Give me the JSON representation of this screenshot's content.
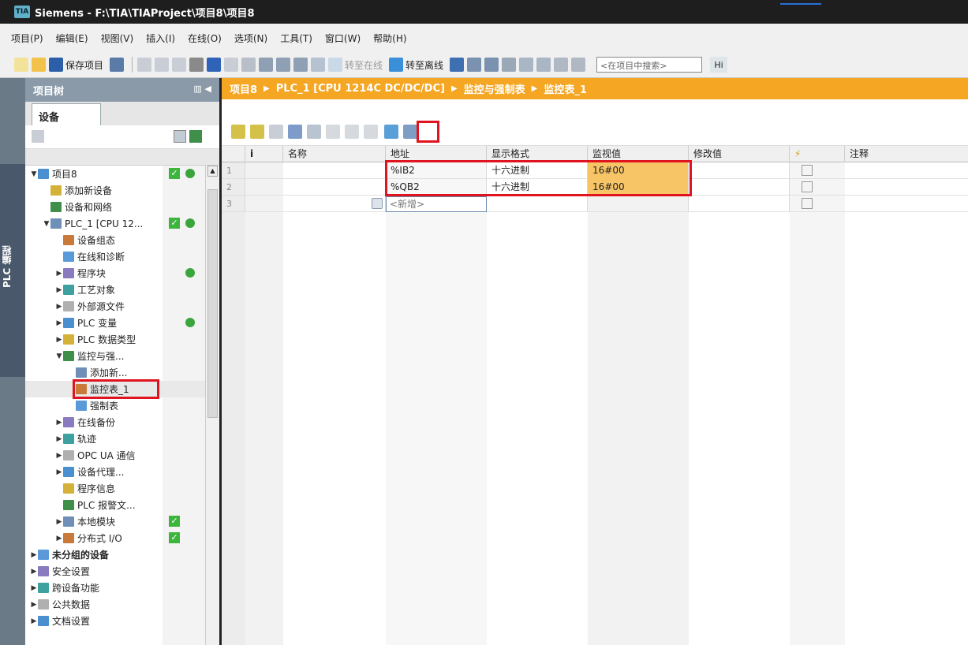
{
  "window": {
    "title": "Siemens  -  F:\\TIA\\TIAProject\\项目8\\项目8",
    "logo_text": "TIA"
  },
  "menu": [
    "项目(P)",
    "编辑(E)",
    "视图(V)",
    "插入(I)",
    "在线(O)",
    "选项(N)",
    "工具(T)",
    "窗口(W)",
    "帮助(H)"
  ],
  "toolbar": {
    "save_label": "保存项目",
    "go_online_label": "转至在线",
    "go_offline_label": "转至离线",
    "search_placeholder": "<在项目中搜索>",
    "find_icon_text": "Hi"
  },
  "left_strip": {
    "label": "PLC 编程"
  },
  "project_tree": {
    "header": "项目树",
    "devices_tab": "设备",
    "items": [
      {
        "label": "项目8",
        "indent": 0,
        "arrow": "down",
        "icon": "project-icon",
        "check": true,
        "dot": true
      },
      {
        "label": "添加新设备",
        "indent": 1,
        "arrow": "",
        "icon": "add-device-icon"
      },
      {
        "label": "设备和网络",
        "indent": 1,
        "arrow": "",
        "icon": "network-icon"
      },
      {
        "label": "PLC_1 [CPU 12...",
        "indent": 1,
        "arrow": "down",
        "icon": "plc-icon",
        "check": true,
        "dot": true
      },
      {
        "label": "设备组态",
        "indent": 2,
        "arrow": "",
        "icon": "device-config-icon"
      },
      {
        "label": "在线和诊断",
        "indent": 2,
        "arrow": "",
        "icon": "diagnostics-icon"
      },
      {
        "label": "程序块",
        "indent": 2,
        "arrow": "right",
        "icon": "program-blocks-icon",
        "dot": true
      },
      {
        "label": "工艺对象",
        "indent": 2,
        "arrow": "right",
        "icon": "technology-objects-icon"
      },
      {
        "label": "外部源文件",
        "indent": 2,
        "arrow": "right",
        "icon": "external-source-icon"
      },
      {
        "label": "PLC 变量",
        "indent": 2,
        "arrow": "right",
        "icon": "plc-tags-icon",
        "dot": true
      },
      {
        "label": "PLC 数据类型",
        "indent": 2,
        "arrow": "right",
        "icon": "plc-datatypes-icon"
      },
      {
        "label": "监控与强...",
        "indent": 2,
        "arrow": "down",
        "icon": "watch-force-folder-icon"
      },
      {
        "label": "添加新...",
        "indent": 3,
        "arrow": "",
        "icon": "add-new-icon"
      },
      {
        "label": "监控表_1",
        "indent": 3,
        "arrow": "",
        "icon": "watch-table-icon",
        "selected": true
      },
      {
        "label": "强制表",
        "indent": 3,
        "arrow": "",
        "icon": "force-table-icon"
      },
      {
        "label": "在线备份",
        "indent": 2,
        "arrow": "right",
        "icon": "online-backup-icon"
      },
      {
        "label": "轨迹",
        "indent": 2,
        "arrow": "right",
        "icon": "traces-icon"
      },
      {
        "label": "OPC UA 通信",
        "indent": 2,
        "arrow": "right",
        "icon": "opcua-icon"
      },
      {
        "label": "设备代理...",
        "indent": 2,
        "arrow": "right",
        "icon": "device-proxy-icon"
      },
      {
        "label": "程序信息",
        "indent": 2,
        "arrow": "",
        "icon": "program-info-icon"
      },
      {
        "label": "PLC 报警文...",
        "indent": 2,
        "arrow": "",
        "icon": "plc-alarm-icon"
      },
      {
        "label": "本地模块",
        "indent": 2,
        "arrow": "right",
        "icon": "local-modules-icon",
        "check": true
      },
      {
        "label": "分布式 I/O",
        "indent": 2,
        "arrow": "right",
        "icon": "distributed-io-icon",
        "check": true
      },
      {
        "label": "未分组的设备",
        "indent": 0,
        "arrow": "right",
        "icon": "ungrouped-devices-icon",
        "bold": true
      },
      {
        "label": "安全设置",
        "indent": 0,
        "arrow": "right",
        "icon": "security-icon"
      },
      {
        "label": "跨设备功能",
        "indent": 0,
        "arrow": "right",
        "icon": "cross-device-icon"
      },
      {
        "label": "公共数据",
        "indent": 0,
        "arrow": "right",
        "icon": "common-data-icon"
      },
      {
        "label": "文档设置",
        "indent": 0,
        "arrow": "right",
        "icon": "doc-settings-icon"
      }
    ]
  },
  "breadcrumb": [
    "项目8",
    "PLC_1 [CPU 1214C DC/DC/DC]",
    "监控与强制表",
    "监控表_1"
  ],
  "watch_table": {
    "columns": [
      "i",
      "名称",
      "地址",
      "显示格式",
      "监视值",
      "修改值",
      "⚡",
      "注释"
    ],
    "rows": [
      {
        "num": "1",
        "name": "",
        "address": "%IB2",
        "format": "十六进制",
        "monitor": "16#00",
        "modify": ""
      },
      {
        "num": "2",
        "name": "",
        "address": "%QB2",
        "format": "十六进制",
        "monitor": "16#00",
        "modify": ""
      },
      {
        "num": "3",
        "name": "",
        "address": "<新增>",
        "format": "",
        "monitor": "",
        "modify": ""
      }
    ]
  },
  "colors": {
    "accent": "#f5a623",
    "monitor_bg": "#f7c466",
    "highlight": "#e0141e"
  }
}
